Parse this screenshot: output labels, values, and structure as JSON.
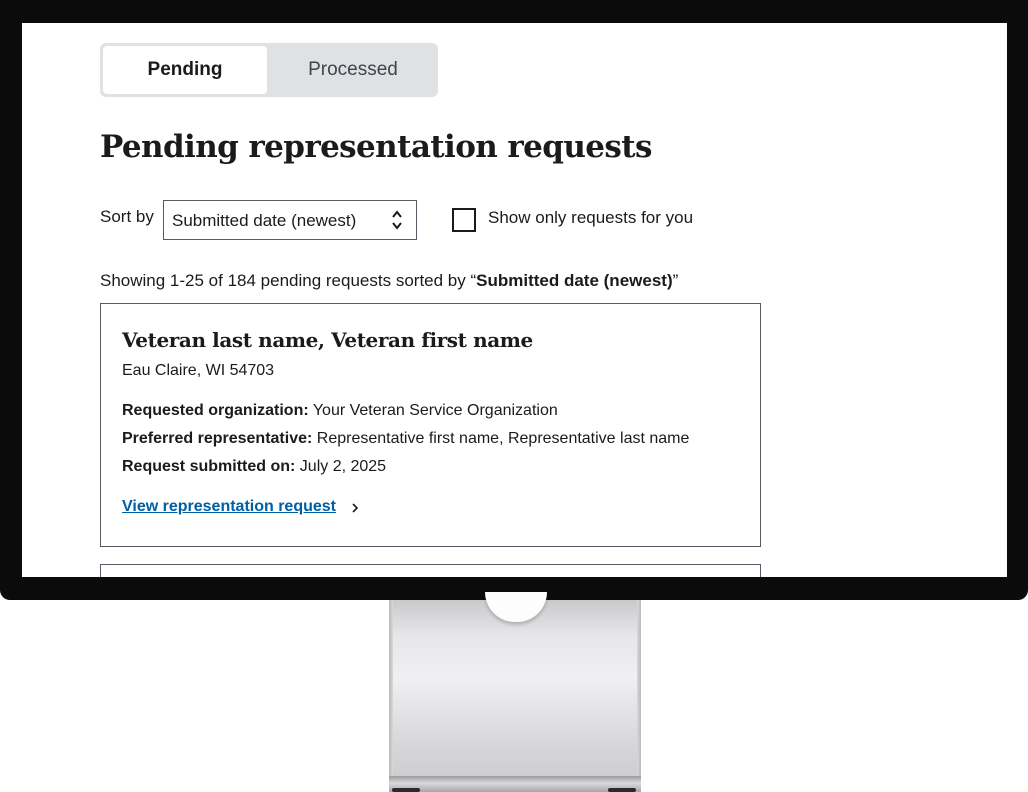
{
  "tabs": [
    {
      "label": "Pending",
      "active": true
    },
    {
      "label": "Processed",
      "active": false
    }
  ],
  "page": {
    "title": "Pending representation requests"
  },
  "sort": {
    "label": "Sort by",
    "selected": "Submitted date (newest)"
  },
  "filter": {
    "label": "Show only requests for you",
    "checked": false
  },
  "results": {
    "prefix": "Showing 1-25 of 184 pending requests sorted by “",
    "sort_name": "Submitted date (newest)",
    "suffix": "”"
  },
  "requests": [
    {
      "name": "Veteran last name, Veteran first name",
      "location": "Eau Claire, WI 54703",
      "org_label": "Requested organization:",
      "org_value": "Your Veteran Service Organization",
      "rep_label": "Preferred representative:",
      "rep_value": "Representative first name, Representative last name",
      "date_label": "Request submitted on:",
      "date_value": "July 2, 2025",
      "link_label": "View representation request"
    }
  ],
  "colors": {
    "link": "#005ea2",
    "tab_background": "#dfe1e2",
    "border": "#565c65",
    "bezel": "#0b0b0b"
  }
}
